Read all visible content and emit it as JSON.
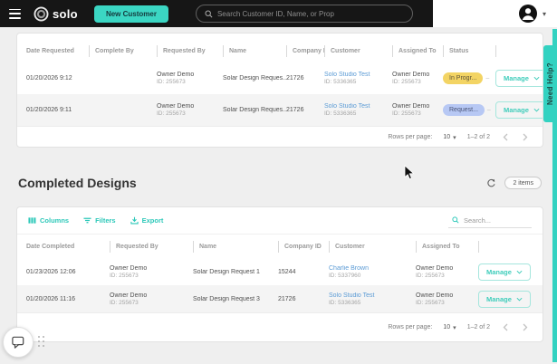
{
  "header": {
    "logo_text": "solo",
    "new_customer_label": "New Customer",
    "search_placeholder": "Search Customer ID, Name, or Prop"
  },
  "pending": {
    "columns": [
      "Date Requested",
      "Complete By",
      "Requested By",
      "Name",
      "Company ID",
      "Customer",
      "Assigned To",
      "Status"
    ],
    "status_more": "–",
    "rows": [
      {
        "date_requested": "01/20/2026 9:12",
        "complete_by": "",
        "requested_by_name": "Owner Demo",
        "requested_by_id": "ID: 255673",
        "name": "Solar Design Reques...",
        "company_id": "21726",
        "customer_name": "Solo Studio Test",
        "customer_id": "ID: 5336365",
        "assigned_to_name": "Owner Demo",
        "assigned_to_id": "ID: 255673",
        "status": "In Progr...",
        "status_color": "#F3D464",
        "manage_label": "Manage"
      },
      {
        "date_requested": "01/20/2026 9:11",
        "complete_by": "",
        "requested_by_name": "Owner Demo",
        "requested_by_id": "ID: 255673",
        "name": "Solar Design Reques...",
        "company_id": "21726",
        "customer_name": "Solo Studio Test",
        "customer_id": "ID: 5336365",
        "assigned_to_name": "Owner Demo",
        "assigned_to_id": "ID: 255673",
        "status": "Request...",
        "status_color": "#B7C8F4",
        "manage_label": "Manage"
      }
    ],
    "pagination": {
      "rows_per_page_label": "Rows per page:",
      "rows_per_page_value": "10",
      "range": "1–2 of 2"
    }
  },
  "completed": {
    "title": "Completed Designs",
    "items_badge": "2 items",
    "toolbar": {
      "columns_label": "Columns",
      "filters_label": "Filters",
      "export_label": "Export",
      "search_placeholder": "Search..."
    },
    "columns": [
      "Date Completed",
      "Requested By",
      "Name",
      "Company ID",
      "Customer",
      "Assigned To"
    ],
    "rows": [
      {
        "date_completed": "01/23/2026 12:06",
        "requested_by_name": "Owner Demo",
        "requested_by_id": "ID: 255673",
        "name": "Solar Design Request 1",
        "company_id": "15244",
        "customer_name": "Charlie Brown",
        "customer_id": "ID: 5337960",
        "assigned_to_name": "Owner Demo",
        "assigned_to_id": "ID: 255673",
        "manage_label": "Manage"
      },
      {
        "date_completed": "01/20/2026 11:16",
        "requested_by_name": "Owner Demo",
        "requested_by_id": "ID: 255673",
        "name": "Solar Design Request 3",
        "company_id": "21726",
        "customer_name": "Solo Studio Test",
        "customer_id": "ID: 5336365",
        "assigned_to_name": "Owner Demo",
        "assigned_to_id": "ID: 255673",
        "manage_label": "Manage"
      }
    ],
    "pagination": {
      "rows_per_page_label": "Rows per page:",
      "rows_per_page_value": "10",
      "range": "1–2 of 2"
    }
  },
  "need_help": {
    "label": "Need Help?"
  },
  "colors": {
    "accent_teal": "#35D4C2",
    "topbar_black": "#161616",
    "status_in_progress_bg": "#F3D464",
    "status_requested_bg": "#B7C8F4",
    "link_blue": "#5B9BD5"
  }
}
